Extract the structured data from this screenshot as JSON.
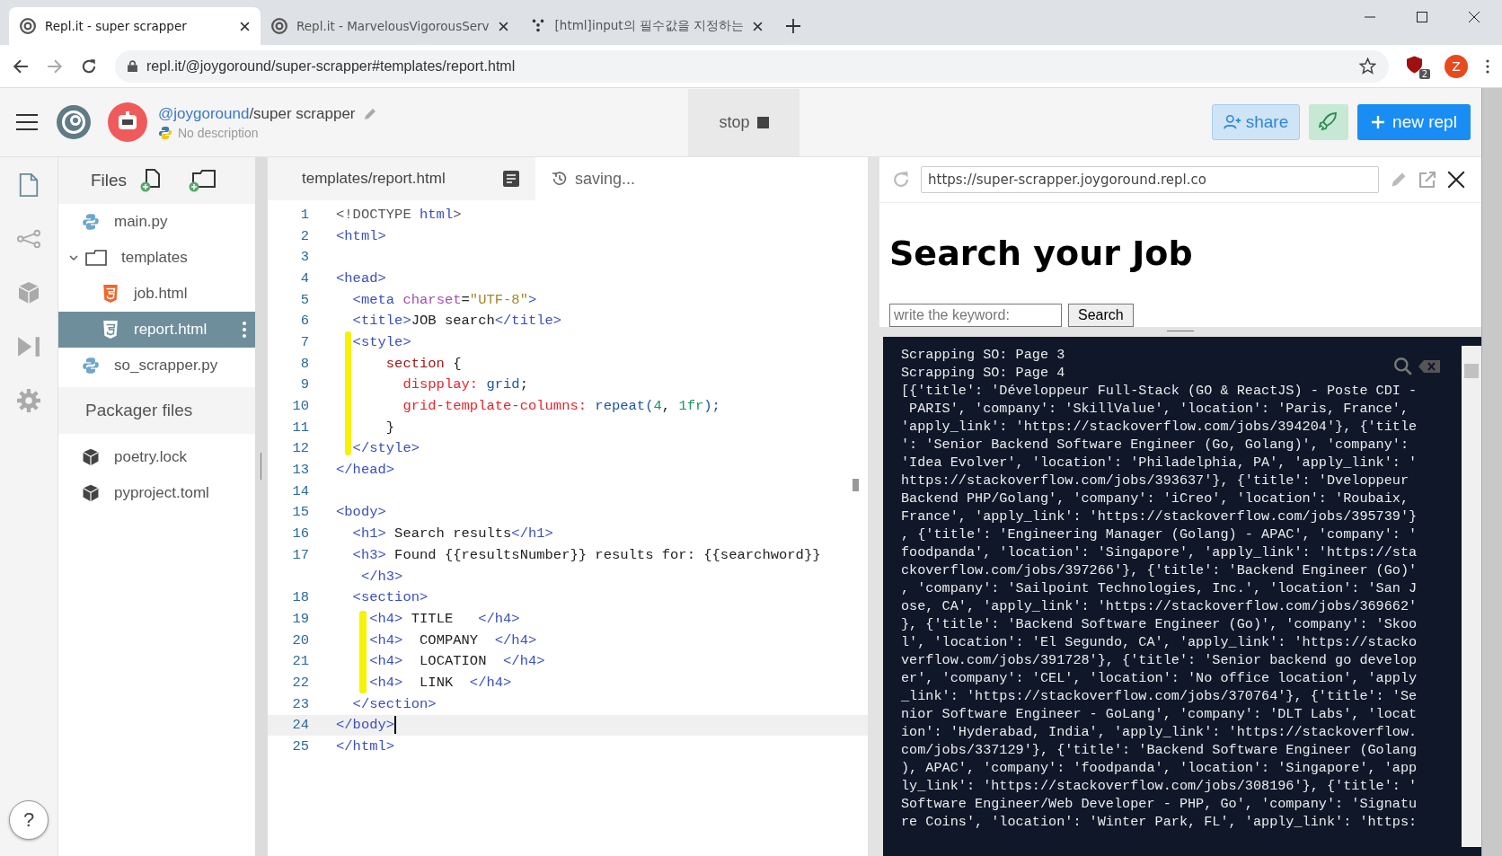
{
  "browser": {
    "tabs": [
      {
        "title": "Repl.it - super scrapper",
        "selected": true,
        "kind": "replit"
      },
      {
        "title": "Repl.it - MarvelousVigorousServ",
        "selected": false,
        "kind": "replit"
      },
      {
        "title": "[html]input의 필수값을 지정하는",
        "selected": false,
        "kind": "dots"
      }
    ],
    "url": "repl.it/@joygoround/super-scrapper#templates/report.html",
    "profile_initial": "Z",
    "extension_badge": "2"
  },
  "header": {
    "owner": "@joygoround",
    "repl_name": "/super scrapper",
    "description": "No description",
    "stop_label": "stop",
    "share_label": "share",
    "new_repl_label": "new repl"
  },
  "files": {
    "title": "Files",
    "items": [
      {
        "name": "main.py",
        "kind": "python",
        "selected": false
      },
      {
        "name": "templates",
        "kind": "folder",
        "selected": false,
        "expanded": true,
        "children": [
          {
            "name": "job.html",
            "kind": "html",
            "selected": false
          },
          {
            "name": "report.html",
            "kind": "html",
            "selected": true
          }
        ]
      },
      {
        "name": "so_scrapper.py",
        "kind": "python",
        "selected": false
      }
    ],
    "packager_title": "Packager files",
    "packager_items": [
      {
        "name": "poetry.lock"
      },
      {
        "name": "pyproject.toml"
      }
    ]
  },
  "editor": {
    "tab": "templates/report.html",
    "status": "saving...",
    "lines": [
      {
        "number": "1",
        "current": false,
        "tokens": [
          {
            "t": "<!DOCTYPE",
            "kind": "doctype"
          },
          {
            "t": " html",
            "kind": "tag"
          },
          {
            "t": ">",
            "kind": "doctype"
          }
        ]
      },
      {
        "number": "2",
        "current": false,
        "tokens": [
          {
            "t": "<html>",
            "kind": "tag"
          }
        ]
      },
      {
        "number": "3",
        "current": false
      },
      {
        "number": "4",
        "current": false,
        "tokens": [
          {
            "t": "<head>",
            "kind": "tag"
          }
        ]
      },
      {
        "number": "5",
        "current": false,
        "tokens": [
          {
            "t": "  <meta",
            "kind": "tag"
          },
          {
            "t": " charset",
            "kind": "attr"
          },
          {
            "t": "=",
            "kind": "text"
          },
          {
            "t": "\"UTF-8\"",
            "kind": "string"
          },
          {
            "t": ">",
            "kind": "tag"
          }
        ]
      },
      {
        "number": "6",
        "current": false,
        "tokens": [
          {
            "t": "  <title>",
            "kind": "tag"
          },
          {
            "t": "JOB search",
            "kind": "text"
          },
          {
            "t": "</title>",
            "kind": "tag"
          }
        ]
      },
      {
        "number": "7",
        "current": false,
        "tokens": [
          {
            "t": "  <style>",
            "kind": "tag"
          }
        ]
      },
      {
        "number": "8",
        "current": false,
        "tokens": [
          {
            "t": "      section",
            "kind": "selector"
          },
          {
            "t": " {",
            "kind": "text"
          }
        ]
      },
      {
        "number": "9",
        "current": false,
        "tokens": [
          {
            "t": "        dispplay:",
            "kind": "prop"
          },
          {
            "t": " grid",
            "kind": "value"
          },
          {
            "t": ";",
            "kind": "text"
          }
        ]
      },
      {
        "number": "10",
        "current": false,
        "tokens": [
          {
            "t": "        grid-template-columns:",
            "kind": "prop"
          },
          {
            "t": " repeat(",
            "kind": "value"
          },
          {
            "t": "4",
            "kind": "number"
          },
          {
            "t": ", ",
            "kind": "text"
          },
          {
            "t": "1fr",
            "kind": "number"
          },
          {
            "t": ");",
            "kind": "value"
          }
        ]
      },
      {
        "number": "11",
        "current": false,
        "tokens": [
          {
            "t": "      }",
            "kind": "text"
          }
        ]
      },
      {
        "number": "12",
        "current": false,
        "tokens": [
          {
            "t": "  </style>",
            "kind": "tag"
          }
        ]
      },
      {
        "number": "13",
        "current": false,
        "tokens": [
          {
            "t": "</head>",
            "kind": "tag"
          }
        ]
      },
      {
        "number": "14",
        "current": false
      },
      {
        "number": "15",
        "current": false,
        "tokens": [
          {
            "t": "<body>",
            "kind": "tag"
          }
        ]
      },
      {
        "number": "16",
        "current": false,
        "tokens": [
          {
            "t": "  <h1>",
            "kind": "tag"
          },
          {
            "t": " Search results",
            "kind": "text"
          },
          {
            "t": "</h1>",
            "kind": "tag"
          }
        ]
      },
      {
        "number": "17",
        "current": false,
        "tokens": [
          {
            "t": "  <h3>",
            "kind": "tag"
          },
          {
            "t": " Found {{resultsNumber}} results for: {{searchword}}",
            "kind": "text"
          }
        ],
        "wrapped": [
          {
            "t": "   </h3>",
            "kind": "tag"
          }
        ]
      },
      {
        "number": "18",
        "current": false,
        "tokens": [
          {
            "t": "  <section>",
            "kind": "tag"
          }
        ]
      },
      {
        "number": "19",
        "current": false,
        "tokens": [
          {
            "t": "    <h4>",
            "kind": "tag"
          },
          {
            "t": " TITLE   ",
            "kind": "text"
          },
          {
            "t": "</h4>",
            "kind": "tag"
          }
        ]
      },
      {
        "number": "20",
        "current": false,
        "tokens": [
          {
            "t": "    <h4>",
            "kind": "tag"
          },
          {
            "t": "  COMPANY  ",
            "kind": "text"
          },
          {
            "t": "</h4>",
            "kind": "tag"
          }
        ]
      },
      {
        "number": "21",
        "current": false,
        "tokens": [
          {
            "t": "    <h4>",
            "kind": "tag"
          },
          {
            "t": "  LOCATION  ",
            "kind": "text"
          },
          {
            "t": "</h4>",
            "kind": "tag"
          }
        ]
      },
      {
        "number": "22",
        "current": false,
        "tokens": [
          {
            "t": "    <h4>",
            "kind": "tag"
          },
          {
            "t": "  LINK  ",
            "kind": "text"
          },
          {
            "t": "</h4>",
            "kind": "tag"
          }
        ]
      },
      {
        "number": "23",
        "current": false,
        "tokens": [
          {
            "t": "  </section>",
            "kind": "tag"
          }
        ]
      },
      {
        "number": "24",
        "current": true,
        "tokens": [
          {
            "t": "</body>",
            "kind": "tag"
          }
        ]
      },
      {
        "number": "25",
        "current": false,
        "tokens": [
          {
            "t": "</html>",
            "kind": "tag"
          }
        ]
      }
    ]
  },
  "preview": {
    "url": "https://super-scrapper.joygoround.repl.co",
    "heading": "Search your Job",
    "search_placeholder": "write the keyword:",
    "search_button": "Search"
  },
  "console": {
    "lines": [
      "Scrapping SO: Page 3",
      "Scrapping SO: Page 4",
      "[{'title': 'Développeur Full-Stack (GO & ReactJS) - Poste CDI -",
      " PARIS', 'company': 'SkillValue', 'location': 'Paris, France',",
      "'apply_link': 'https://stackoverflow.com/jobs/394204'}, {'title",
      "': 'Senior Backend Software Engineer (Go, Golang)', 'company':",
      "'Idea Evolver', 'location': 'Philadelphia, PA', 'apply_link': '",
      "https://stackoverflow.com/jobs/393637'}, {'title': 'Dveloppeur",
      "Backend PHP/Golang', 'company': 'iCreo', 'location': 'Roubaix,",
      "France', 'apply_link': 'https://stackoverflow.com/jobs/395739'}",
      ", {'title': 'Engineering Manager (Golang) - APAC', 'company': '",
      "foodpanda', 'location': 'Singapore', 'apply_link': 'https://sta",
      "ckoverflow.com/jobs/397266'}, {'title': 'Backend Engineer (Go)'",
      ", 'company': 'Sailpoint Technologies, Inc.', 'location': 'San J",
      "ose, CA', 'apply_link': 'https://stackoverflow.com/jobs/369662'",
      "}, {'title': 'Backend Software Engineer (Go)', 'company': 'Skoo",
      "l', 'location': 'El Segundo, CA', 'apply_link': 'https://stacko",
      "verflow.com/jobs/391728'}, {'title': 'Senior backend go develop",
      "er', 'company': 'CEL', 'location': 'No office location', 'apply",
      "_link': 'https://stackoverflow.com/jobs/370764'}, {'title': 'Se",
      "nior Software Engineer - GoLang', 'company': 'DLT Labs', 'locat",
      "ion': 'Hyderabad, India', 'apply_link': 'https://stackoverflow.",
      "com/jobs/337129'}, {'title': 'Backend Software Engineer (Golang",
      "), APAC', 'company': 'foodpanda', 'location': 'Singapore', 'app",
      "ly_link': 'https://stackoverflow.com/jobs/308196'}, {'title': '",
      "Software Engineer/Web Developer - PHP, Go', 'company': 'Signatu",
      "re Coins', 'location': 'Winter Park, FL', 'apply_link': 'https:"
    ]
  },
  "help_label": "?"
}
